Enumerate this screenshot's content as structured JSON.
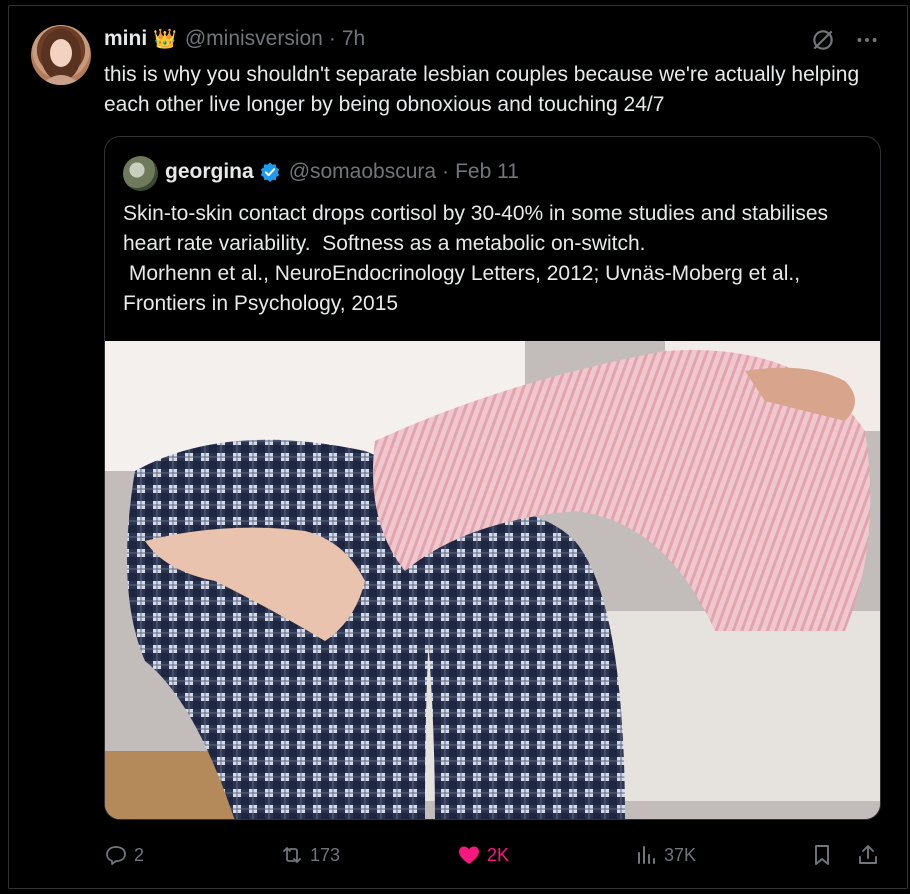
{
  "tweet": {
    "name": "mini",
    "crown": "👑",
    "handle": "@minisversion",
    "separator": "·",
    "time": "7h",
    "text": "this is why you shouldn't separate lesbian couples because we're actually helping each other live longer by being obnoxious and touching 24/7"
  },
  "quote": {
    "name": "georgina",
    "handle": "@somaobscura",
    "separator": "·",
    "date": "Feb 11",
    "text": "Skin-to-skin contact drops cortisol by 30-40% in some studies and stabilises heart rate variability.  Softness as a metabolic on-switch.\n Morhenn et al., NeuroEndocrinology Letters, 2012; Uvnäs-Moberg et al., Frontiers in Psychology, 2015"
  },
  "actions": {
    "replies": "2",
    "reposts": "173",
    "likes": "2K",
    "views": "37K"
  },
  "colors": {
    "like": "#f91880",
    "verified": "#1d9bf0",
    "muted": "#71767b",
    "text": "#e7e9ea",
    "border": "#2f3336"
  }
}
